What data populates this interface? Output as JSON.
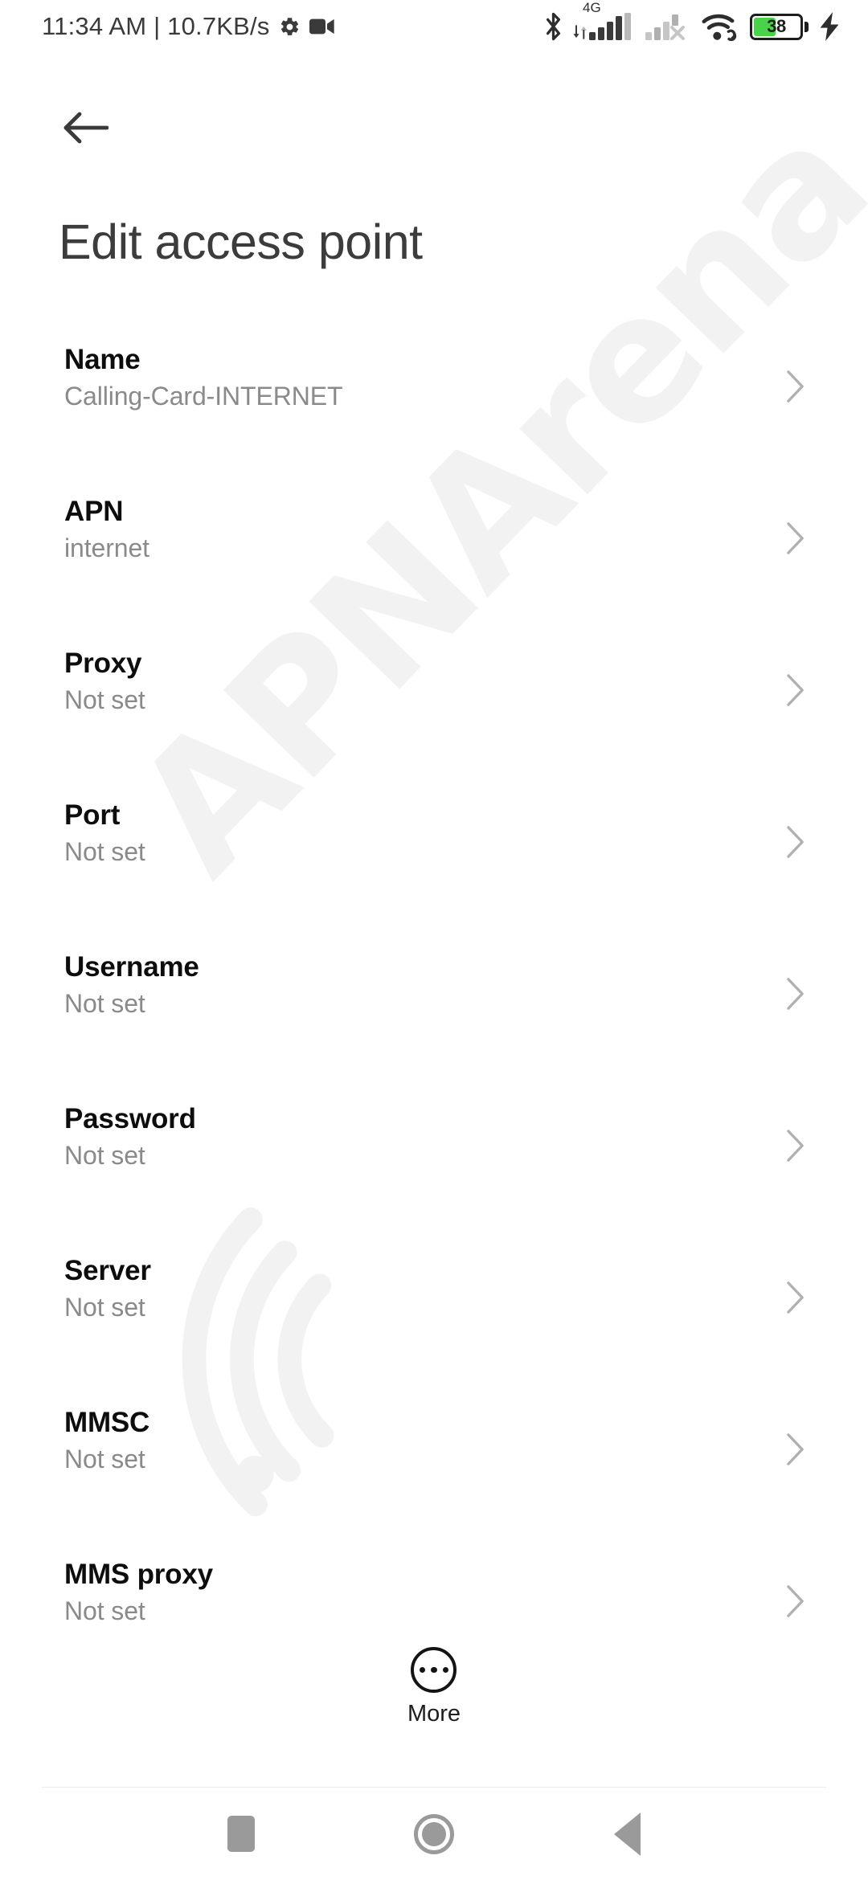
{
  "status_bar": {
    "clock_text": "11:34 AM | 10.7KB/s",
    "icons": {
      "settings": "gear-icon",
      "recording": "video-camera-icon",
      "bluetooth": "bluetooth-icon",
      "network_type": "4G",
      "sim1_signal": "signal-bars-icon",
      "sim2_signal": "signal-bars-off-icon",
      "wifi": "wifi-link-icon"
    },
    "battery": {
      "level_text": "38",
      "level_percent": 38,
      "charging": true,
      "fill_color": "#49d24a"
    }
  },
  "app_bar": {
    "back_icon": "arrow-back-icon",
    "title": "Edit access point"
  },
  "settings_list": [
    {
      "label": "Name",
      "value": "Calling-Card-INTERNET"
    },
    {
      "label": "APN",
      "value": "internet"
    },
    {
      "label": "Proxy",
      "value": "Not set"
    },
    {
      "label": "Port",
      "value": "Not set"
    },
    {
      "label": "Username",
      "value": "Not set"
    },
    {
      "label": "Password",
      "value": "Not set"
    },
    {
      "label": "Server",
      "value": "Not set"
    },
    {
      "label": "MMSC",
      "value": "Not set"
    },
    {
      "label": "MMS proxy",
      "value": "Not set"
    }
  ],
  "more_button": {
    "label": "More",
    "icon": "overflow-dots-icon"
  },
  "nav_bar": {
    "recents_icon": "square-recents-icon",
    "home_icon": "circle-home-icon",
    "back_icon": "triangle-back-icon"
  },
  "watermark": {
    "text": "APNArena"
  },
  "colors": {
    "background": "#ffffff",
    "label": "#0d0d0d",
    "value": "#8a8a8a",
    "title": "#3c3c3c",
    "chevron": "#b0b0b0",
    "nav": "#9a9a9a",
    "watermark": "#f2f2f2"
  }
}
